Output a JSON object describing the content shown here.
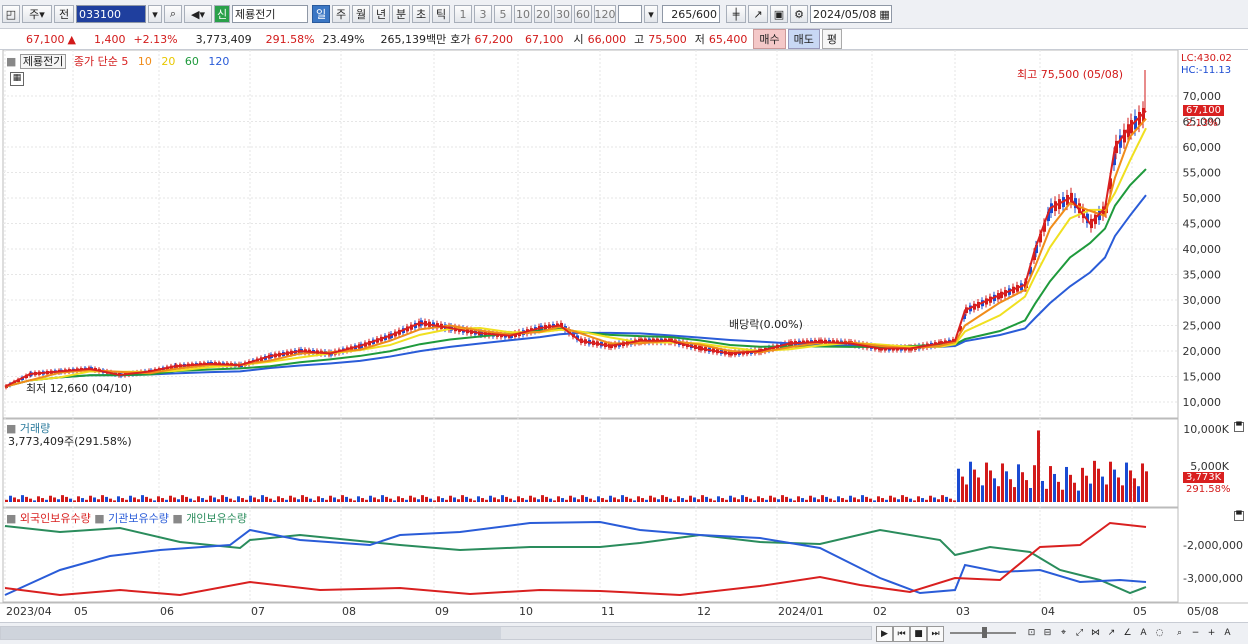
{
  "toolbar": {
    "market_type": "주",
    "prefix": "전",
    "code": "033100",
    "badge": "신",
    "name": "제룡전기",
    "periods": [
      "일",
      "주",
      "월",
      "년",
      "분",
      "초",
      "틱"
    ],
    "selected_period": "일",
    "intervals": [
      "1",
      "3",
      "5",
      "10",
      "20",
      "30",
      "60",
      "120"
    ],
    "count": "265",
    "count_max": "/600",
    "date": "2024/05/08"
  },
  "quote": {
    "price": "67,100",
    "arrow": "▲",
    "change": "1,400",
    "change_pct": "+2.13%",
    "volume": "3,773,409",
    "volume_ratio": "291.58%",
    "turnover": "23.49%",
    "amount": "265,139백만",
    "hoga_label": "호가",
    "ask": "67,200",
    "bid": "67,100",
    "open_label": "시",
    "open": "66,000",
    "high_label": "고",
    "high": "75,500",
    "low_label": "저",
    "low": "65,400",
    "buy_label": "매수",
    "sell_label": "매도",
    "avg_label": "평"
  },
  "price_panel": {
    "title": "제룡전기",
    "ma_label": "종가 단순",
    "ma_periods": [
      "5",
      "10",
      "20",
      "60",
      "120"
    ],
    "ma_colors": [
      "#d92020",
      "#f08c1a",
      "#f0e020",
      "#1f9a3c",
      "#2a5cd8"
    ],
    "y_ticks": [
      "70,000",
      "65,000",
      "60,000",
      "55,000",
      "50,000",
      "45,000",
      "40,000",
      "35,000",
      "30,000",
      "25,000",
      "20,000",
      "15,000",
      "10,000"
    ],
    "high_annotation": "최고 75,500 (05/08)",
    "low_annotation": "최저 12,660 (04/10)",
    "dividend_annotation": "배당락(0.00%)",
    "lc": "LC:430.02",
    "hc": "HC:-11.13",
    "current_price_tag": "67,100",
    "current_pct_tag": "2.13%"
  },
  "volume_panel": {
    "title": "거래량",
    "value": "3,773,409주(291.58%)",
    "y_ticks": [
      "10,000K",
      "5,000K"
    ],
    "current_tag": "3,773K",
    "current_pct": "291.58%"
  },
  "holdings_panel": {
    "series": [
      {
        "name": "외국인보유수량",
        "color": "#d92020"
      },
      {
        "name": "기관보유수량",
        "color": "#2a5cd8"
      },
      {
        "name": "개인보유수량",
        "color": "#2a8c5c"
      }
    ],
    "y_ticks": [
      "-2,000,000",
      "-3,000,000"
    ]
  },
  "x_axis": {
    "labels": [
      "2023/04",
      "05",
      "06",
      "07",
      "08",
      "09",
      "10",
      "11",
      "12",
      "2024/01",
      "02",
      "03",
      "04",
      "05"
    ],
    "right_label": "05/08"
  }
}
